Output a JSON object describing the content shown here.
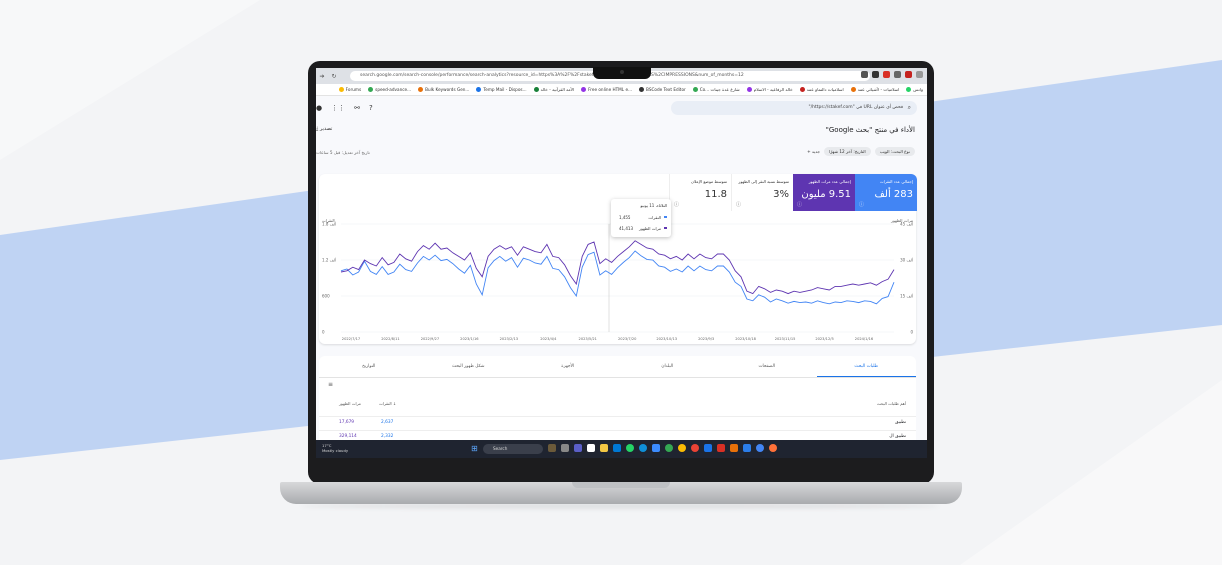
{
  "colors": {
    "clicks": "#4285f4",
    "impressions": "#5e35b1",
    "bg_band": "#b7cff5",
    "laptop": "#1c1c1e"
  },
  "browser": {
    "url": "search.google.com/search-console/performance/search-analytics?resource_id=https%3A%2F%2Fstakef.com%2F&metrics=CLICKS%2CIMPRESSIONS&num_of_months=12",
    "bookmarks": [
      "واتس",
      "اسلاميات - لأشيائي عمد",
      "اسلاميات دالتماو عمد",
      "خالد الرفاعيه - الاسلام",
      "Co... شارع عدة جينات",
      "BSCode Text Editor",
      "Free online HTML e...",
      "الأمة القرآنية - خالد",
      "Temp Mail - Dispos...",
      "Bulk Keywords Gen...",
      "speed-advance...",
      "Forums"
    ]
  },
  "app": {
    "search_placeholder": "فحص أي عنوان URL في \"https://stakef.com/\"",
    "page_title": "الأداء في منتج \"بحث Google\"",
    "export_label": "تصدير",
    "filters": [
      "نوع البحث: الويب",
      "التاريخ: آخر 12 شهرًا"
    ],
    "add_filter_label": "جديد",
    "last_update": "تاريخ آخر تعديل: قبل 5 ساعات"
  },
  "metrics": {
    "clicks": {
      "label": "إجمالي عدد النقرات",
      "value": "283 ألف"
    },
    "impressions": {
      "label": "إجمالي عدد مرات الظهور",
      "value": "9.51 مليون"
    },
    "ctr": {
      "label": "متوسط نسبة النقر إلى الظهور",
      "value": "3%"
    },
    "position": {
      "label": "متوسط موضع الإعلان",
      "value": "11.8"
    }
  },
  "chart_data": {
    "type": "line",
    "ylabel_left": "النقرات",
    "ylabel_right": "مرات الظهور",
    "yticks_left": [
      "0",
      "600",
      "1.2 ألف",
      "1.8 ألف"
    ],
    "yticks_right": [
      "0",
      "15 ألف",
      "30 ألف",
      "45 ألف"
    ],
    "x_ticks": [
      "2022/7/17",
      "2022/8/11",
      "2022/9/27",
      "2023/1/16",
      "2023/2/13",
      "2023/4/4",
      "2023/5/21",
      "2023/7/20",
      "2023/10/13",
      "2023/9/3",
      "2023/10/18",
      "2023/11/15",
      "2023/12/5",
      "2024/1/16"
    ],
    "series": [
      {
        "name": "النقرات",
        "values": [
          1020,
          1050,
          950,
          1000,
          1180,
          1010,
          960,
          1090,
          960,
          1000,
          1130,
          1040,
          1010,
          1150,
          1260,
          1200,
          1280,
          1190,
          1210,
          1140,
          1050,
          980,
          1110,
          800,
          620,
          1070,
          1190,
          1260,
          1180,
          1240,
          1080,
          1230,
          1200,
          1150,
          1130,
          1260,
          1060,
          1040,
          920,
          740,
          600,
          1080,
          1290,
          1330,
          950,
          1020,
          960,
          1070,
          1160,
          1240,
          1350,
          1270,
          1210,
          1200,
          1100,
          1080,
          1010,
          1050,
          1000,
          1100,
          1020,
          1100,
          1040,
          1020,
          1100,
          1100,
          1000,
          830,
          760,
          550,
          520,
          620,
          580,
          500,
          550,
          520,
          480,
          510,
          490,
          500,
          480,
          520,
          490,
          470,
          500,
          490,
          520,
          510,
          490,
          520,
          510,
          470,
          560,
          590,
          830
        ]
      },
      {
        "name": "مرات الظهور",
        "values": [
          25000,
          25500,
          27000,
          26000,
          30000,
          28500,
          27500,
          31000,
          28000,
          29000,
          32500,
          30500,
          29500,
          33500,
          36000,
          34500,
          37000,
          34500,
          35000,
          33000,
          31500,
          30000,
          33000,
          26500,
          23000,
          31500,
          34500,
          36000,
          34500,
          35500,
          32000,
          35500,
          34500,
          33500,
          33000,
          36500,
          31500,
          31000,
          28000,
          23500,
          20000,
          31500,
          36500,
          37500,
          28500,
          30500,
          29000,
          31500,
          33500,
          35500,
          38000,
          36500,
          35000,
          34500,
          32500,
          32000,
          30500,
          31500,
          30000,
          32500,
          30500,
          32500,
          31000,
          30500,
          32500,
          32500,
          30000,
          25500,
          23000,
          17000,
          16000,
          19000,
          18000,
          16500,
          17500,
          17000,
          16000,
          17000,
          16500,
          17000,
          17500,
          18500,
          18000,
          17500,
          19000,
          19000,
          19500,
          20000,
          19500,
          20000,
          20500,
          19500,
          21000,
          22000,
          26000
        ]
      }
    ],
    "ylim_left": [
      0,
      1800
    ],
    "ylim_right": [
      0,
      45000
    ],
    "grid": true
  },
  "tooltip": {
    "date": "الثلاثاء، 11 يونيو",
    "clicks_label": "النقرات",
    "clicks_value": "1,455",
    "impr_label": "مرات الظهور",
    "impr_value": "41,413"
  },
  "table": {
    "tabs": [
      "طلبات البحث",
      "الصفحات",
      "البلدان",
      "الأجهزة",
      "شكل ظهور البحث",
      "التواريخ"
    ],
    "headers": {
      "query": "أهم طلبات البحث",
      "clicks": "النقرات",
      "impressions": "مرات الظهور"
    },
    "rows": [
      {
        "query": "تطبيق",
        "clicks": "2,637",
        "impressions": "17,679"
      },
      {
        "query": "تطبيق ال",
        "clicks": "2,332",
        "impressions": "329,114"
      }
    ]
  },
  "taskbar": {
    "temp": "17°C",
    "weather": "Mostly cloudy",
    "search_label": "Search"
  }
}
